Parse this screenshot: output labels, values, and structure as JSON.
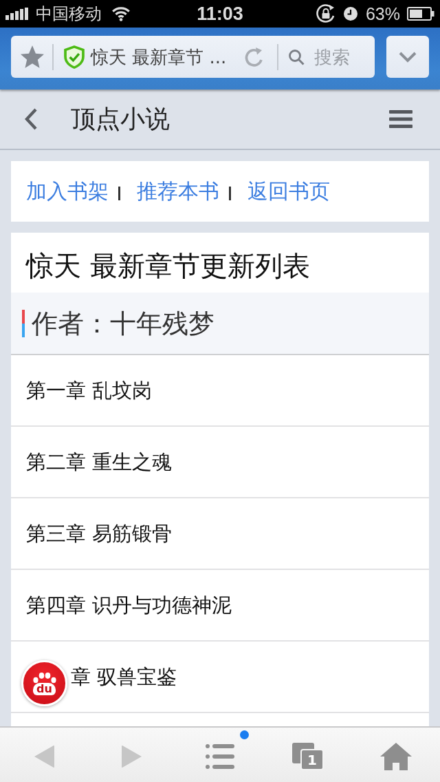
{
  "status_bar": {
    "carrier": "中国移动",
    "time": "11:03",
    "battery": "63%"
  },
  "browser_bar": {
    "address": "惊天 最新章节 ...",
    "search": {
      "placeholder": "搜索"
    }
  },
  "site_header": {
    "title": "顶点小说"
  },
  "actions": [
    {
      "label": "加入书架"
    },
    {
      "label": "推荐本书"
    },
    {
      "label": "返回书页"
    }
  ],
  "book": {
    "title": "惊天 最新章节更新列表",
    "author": "作者：十年残梦"
  },
  "chapters": [
    {
      "kind": "full",
      "title": "第一章 乱坟岗"
    },
    {
      "kind": "full",
      "title": "第二章 重生之魂"
    },
    {
      "kind": "full",
      "title": "第三章 易筋锻骨"
    },
    {
      "kind": "full",
      "title": "第四章 识丹与功德神泥"
    },
    {
      "kind": "covered",
      "title": "章 驭兽宝鉴"
    }
  ],
  "float_button": {
    "label": "du"
  },
  "toolbar": [
    {
      "kind": "back",
      "disabled": true,
      "badge": false
    },
    {
      "kind": "forward",
      "disabled": true,
      "badge": false
    },
    {
      "kind": "menu",
      "disabled": false,
      "badge": true
    },
    {
      "kind": "tabs",
      "disabled": false,
      "badge": false,
      "count": "1"
    },
    {
      "kind": "home",
      "disabled": false,
      "badge": false
    }
  ]
}
